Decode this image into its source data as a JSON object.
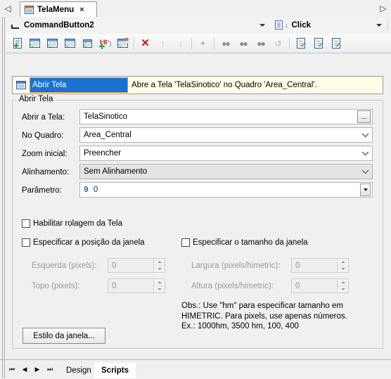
{
  "window": {
    "tabstrip": {
      "scroll_left_icon": "triangle-left-icon",
      "scroll_right_icon": "triangle-right-icon",
      "tabs": [
        {
          "label": "TelaMenu",
          "icon": "window-icon",
          "close_label": "×",
          "active": true
        }
      ]
    }
  },
  "objectbar": {
    "object_icon": "command-button-icon",
    "object_value": "CommandButton2",
    "event_icon": "event-document-icon",
    "event_value": "Click",
    "dropdown_icon": "chevron-down-icon"
  },
  "toolbar": {
    "buttons": [
      {
        "name": "new-screen-action",
        "icon": "doc-plus-icon"
      },
      {
        "name": "new-window-action",
        "icon": "window-plus-icon"
      },
      {
        "name": "new-image-action",
        "icon": "image-plus-icon"
      },
      {
        "name": "new-frame-action",
        "icon": "frame-plus-icon"
      },
      {
        "name": "insert-download-action",
        "icon": "download-plus-icon"
      },
      {
        "name": "insert-loop-action",
        "icon": "loop-plus-icon"
      },
      {
        "name": "insert-report-action",
        "icon": "report-plus-icon"
      },
      {
        "name": "delete-action",
        "icon": "red-x-icon",
        "label": "✕"
      },
      {
        "name": "move-up-action",
        "icon": "arrow-up-icon",
        "label": "↑",
        "disabled": true
      },
      {
        "name": "move-down-action",
        "icon": "arrow-down-icon",
        "label": "↓",
        "disabled": true
      },
      {
        "name": "edit-properties-action",
        "icon": "wand-icon",
        "label": "✦",
        "disabled": true
      },
      {
        "name": "find-action",
        "icon": "binoculars-icon",
        "label": "●●"
      },
      {
        "name": "find-next-action",
        "icon": "binoculars-next-icon",
        "label": "●●"
      },
      {
        "name": "find-prev-action",
        "icon": "binoculars-prev-icon",
        "label": "●●"
      },
      {
        "name": "replace-action",
        "icon": "replace-icon",
        "label": "↺",
        "disabled": true
      },
      {
        "name": "check-script-action",
        "icon": "doc-check-icon"
      },
      {
        "name": "check-all-action",
        "icon": "doc-check-all-icon"
      },
      {
        "name": "validate-action",
        "icon": "doc-validate-icon"
      }
    ]
  },
  "action_list": {
    "icon": "screen-icon",
    "name": "Abrir Tela",
    "description": "Abre a Tela 'TelaSinotico' no Quadro 'Area_Central'."
  },
  "group": {
    "title": "Abrir Tela",
    "fields": [
      {
        "label": "Abrir a Tela:",
        "value": "TelaSinotico",
        "control": "text-with-browse",
        "browse_label": "..."
      },
      {
        "label": "No Quadro:",
        "value": "Area_Central",
        "control": "combobox"
      },
      {
        "label": "Zoom inicial:",
        "value": "Preencher",
        "control": "combobox"
      },
      {
        "label": "Alinhamento:",
        "value": "Sem Alinhamento",
        "control": "combobox",
        "disabled": true
      },
      {
        "label": "Parâmetro:",
        "marker": "9",
        "value": "0",
        "control": "param-combobox"
      }
    ],
    "checkboxes": [
      {
        "name": "habilitar-rolagem",
        "label": "Habilitar rolagem da Tela",
        "checked": false
      },
      {
        "name": "especificar-posicao",
        "label": "Especificar a posição da janela",
        "checked": false
      },
      {
        "name": "especificar-tamanho",
        "label": "Especificar o tamanho da janela",
        "checked": false
      }
    ],
    "spinners": [
      {
        "name": "esquerda",
        "label": "Esquerda (pixels):",
        "value": "0",
        "disabled": true
      },
      {
        "name": "topo",
        "label": "Topo (pixels):",
        "value": "0",
        "disabled": true
      },
      {
        "name": "largura",
        "label": "Largura (pixels/himetric):",
        "value": "0",
        "disabled": true
      },
      {
        "name": "altura",
        "label": "Altura (pixels/himetric):",
        "value": "0",
        "disabled": true
      }
    ],
    "note": "Obs.: Use \"hm\" para especificar tamanho em\nHIMETRIC. Para pixels, use apenas números.\nEx.: 1000hm, 3500 hm, 100, 400",
    "style_button": "Estilo da janela..."
  },
  "bottom": {
    "nav": [
      {
        "name": "first",
        "glyph": "⏮"
      },
      {
        "name": "prev",
        "glyph": "◀"
      },
      {
        "name": "next",
        "glyph": "▶"
      },
      {
        "name": "last",
        "glyph": "⏭"
      }
    ],
    "tabs": [
      {
        "label": "Design",
        "active": false
      },
      {
        "label": "Scripts",
        "active": true
      }
    ]
  },
  "colors": {
    "selection_blue": "#1a72d0",
    "selection_border": "#d98d3e",
    "list_background": "#fffde8",
    "param_marker": "#1565d8",
    "delete_red": "#cc1111"
  }
}
